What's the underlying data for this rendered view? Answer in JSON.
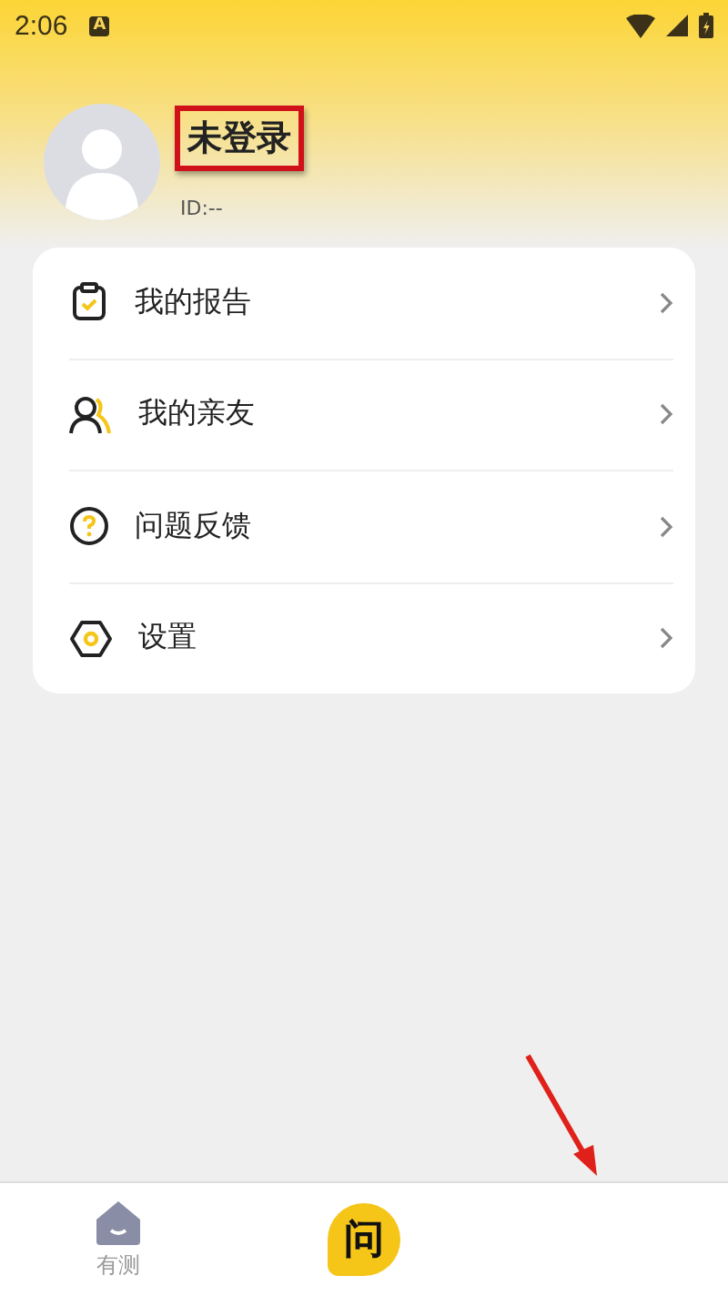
{
  "status_bar": {
    "time": "2:06",
    "notification": "A"
  },
  "profile": {
    "name": "未登录",
    "id": "ID:--",
    "name_highlighted": true
  },
  "menu": [
    {
      "label": "我的报告"
    },
    {
      "label": "我的亲友"
    },
    {
      "label": "问题反馈"
    },
    {
      "label": "设置"
    }
  ],
  "annotation_arrow": true,
  "bottom_nav": [
    {
      "label": "有测",
      "kind": "tab",
      "selected": false
    },
    {
      "label": "问",
      "kind": "center"
    }
  ]
}
